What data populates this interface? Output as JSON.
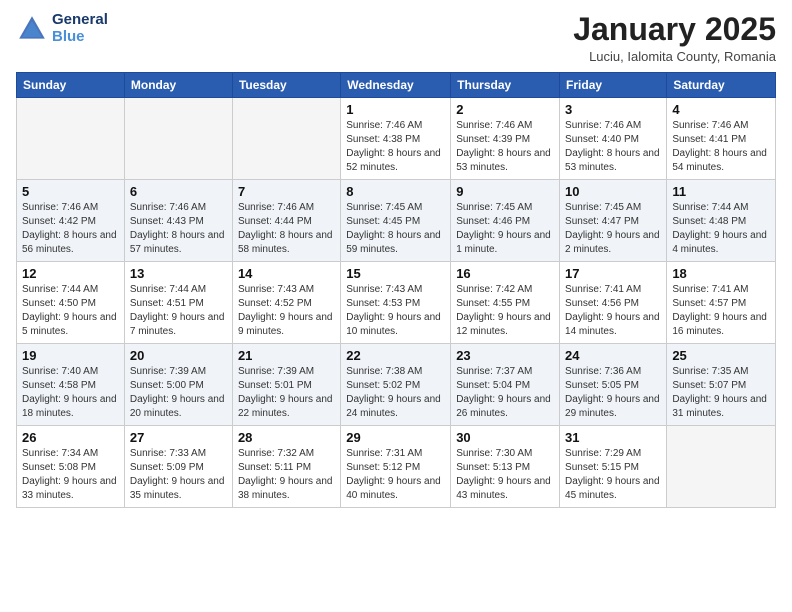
{
  "header": {
    "logo_line1": "General",
    "logo_line2": "Blue",
    "month": "January 2025",
    "location": "Luciu, Ialomita County, Romania"
  },
  "days_of_week": [
    "Sunday",
    "Monday",
    "Tuesday",
    "Wednesday",
    "Thursday",
    "Friday",
    "Saturday"
  ],
  "weeks": [
    [
      {
        "num": "",
        "info": ""
      },
      {
        "num": "",
        "info": ""
      },
      {
        "num": "",
        "info": ""
      },
      {
        "num": "1",
        "info": "Sunrise: 7:46 AM\nSunset: 4:38 PM\nDaylight: 8 hours and 52 minutes."
      },
      {
        "num": "2",
        "info": "Sunrise: 7:46 AM\nSunset: 4:39 PM\nDaylight: 8 hours and 53 minutes."
      },
      {
        "num": "3",
        "info": "Sunrise: 7:46 AM\nSunset: 4:40 PM\nDaylight: 8 hours and 53 minutes."
      },
      {
        "num": "4",
        "info": "Sunrise: 7:46 AM\nSunset: 4:41 PM\nDaylight: 8 hours and 54 minutes."
      }
    ],
    [
      {
        "num": "5",
        "info": "Sunrise: 7:46 AM\nSunset: 4:42 PM\nDaylight: 8 hours and 56 minutes."
      },
      {
        "num": "6",
        "info": "Sunrise: 7:46 AM\nSunset: 4:43 PM\nDaylight: 8 hours and 57 minutes."
      },
      {
        "num": "7",
        "info": "Sunrise: 7:46 AM\nSunset: 4:44 PM\nDaylight: 8 hours and 58 minutes."
      },
      {
        "num": "8",
        "info": "Sunrise: 7:45 AM\nSunset: 4:45 PM\nDaylight: 8 hours and 59 minutes."
      },
      {
        "num": "9",
        "info": "Sunrise: 7:45 AM\nSunset: 4:46 PM\nDaylight: 9 hours and 1 minute."
      },
      {
        "num": "10",
        "info": "Sunrise: 7:45 AM\nSunset: 4:47 PM\nDaylight: 9 hours and 2 minutes."
      },
      {
        "num": "11",
        "info": "Sunrise: 7:44 AM\nSunset: 4:48 PM\nDaylight: 9 hours and 4 minutes."
      }
    ],
    [
      {
        "num": "12",
        "info": "Sunrise: 7:44 AM\nSunset: 4:50 PM\nDaylight: 9 hours and 5 minutes."
      },
      {
        "num": "13",
        "info": "Sunrise: 7:44 AM\nSunset: 4:51 PM\nDaylight: 9 hours and 7 minutes."
      },
      {
        "num": "14",
        "info": "Sunrise: 7:43 AM\nSunset: 4:52 PM\nDaylight: 9 hours and 9 minutes."
      },
      {
        "num": "15",
        "info": "Sunrise: 7:43 AM\nSunset: 4:53 PM\nDaylight: 9 hours and 10 minutes."
      },
      {
        "num": "16",
        "info": "Sunrise: 7:42 AM\nSunset: 4:55 PM\nDaylight: 9 hours and 12 minutes."
      },
      {
        "num": "17",
        "info": "Sunrise: 7:41 AM\nSunset: 4:56 PM\nDaylight: 9 hours and 14 minutes."
      },
      {
        "num": "18",
        "info": "Sunrise: 7:41 AM\nSunset: 4:57 PM\nDaylight: 9 hours and 16 minutes."
      }
    ],
    [
      {
        "num": "19",
        "info": "Sunrise: 7:40 AM\nSunset: 4:58 PM\nDaylight: 9 hours and 18 minutes."
      },
      {
        "num": "20",
        "info": "Sunrise: 7:39 AM\nSunset: 5:00 PM\nDaylight: 9 hours and 20 minutes."
      },
      {
        "num": "21",
        "info": "Sunrise: 7:39 AM\nSunset: 5:01 PM\nDaylight: 9 hours and 22 minutes."
      },
      {
        "num": "22",
        "info": "Sunrise: 7:38 AM\nSunset: 5:02 PM\nDaylight: 9 hours and 24 minutes."
      },
      {
        "num": "23",
        "info": "Sunrise: 7:37 AM\nSunset: 5:04 PM\nDaylight: 9 hours and 26 minutes."
      },
      {
        "num": "24",
        "info": "Sunrise: 7:36 AM\nSunset: 5:05 PM\nDaylight: 9 hours and 29 minutes."
      },
      {
        "num": "25",
        "info": "Sunrise: 7:35 AM\nSunset: 5:07 PM\nDaylight: 9 hours and 31 minutes."
      }
    ],
    [
      {
        "num": "26",
        "info": "Sunrise: 7:34 AM\nSunset: 5:08 PM\nDaylight: 9 hours and 33 minutes."
      },
      {
        "num": "27",
        "info": "Sunrise: 7:33 AM\nSunset: 5:09 PM\nDaylight: 9 hours and 35 minutes."
      },
      {
        "num": "28",
        "info": "Sunrise: 7:32 AM\nSunset: 5:11 PM\nDaylight: 9 hours and 38 minutes."
      },
      {
        "num": "29",
        "info": "Sunrise: 7:31 AM\nSunset: 5:12 PM\nDaylight: 9 hours and 40 minutes."
      },
      {
        "num": "30",
        "info": "Sunrise: 7:30 AM\nSunset: 5:13 PM\nDaylight: 9 hours and 43 minutes."
      },
      {
        "num": "31",
        "info": "Sunrise: 7:29 AM\nSunset: 5:15 PM\nDaylight: 9 hours and 45 minutes."
      },
      {
        "num": "",
        "info": ""
      }
    ]
  ]
}
